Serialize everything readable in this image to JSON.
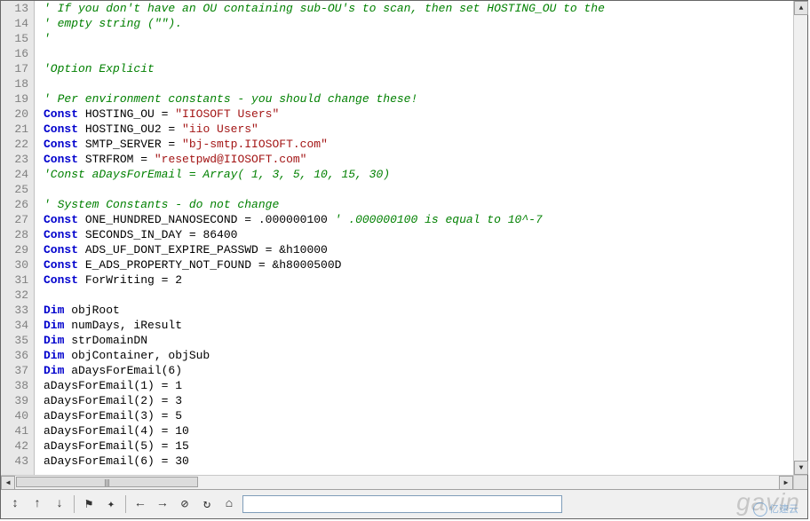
{
  "line_start": 13,
  "lines": [
    [
      {
        "t": "comment",
        "v": "' If you don't have an OU containing sub-OU's to scan, then set HOSTING_OU to the"
      }
    ],
    [
      {
        "t": "comment",
        "v": "' empty string (\"\")."
      }
    ],
    [
      {
        "t": "comment",
        "v": "'"
      }
    ],
    [],
    [
      {
        "t": "comment",
        "v": "'Option Explicit"
      }
    ],
    [],
    [
      {
        "t": "comment",
        "v": "' Per environment constants - you should change these!"
      }
    ],
    [
      {
        "t": "kw",
        "v": "Const"
      },
      {
        "t": "ident",
        "v": " HOSTING_OU = "
      },
      {
        "t": "str",
        "v": "\"IIOSOFT Users\""
      }
    ],
    [
      {
        "t": "kw",
        "v": "Const"
      },
      {
        "t": "ident",
        "v": " HOSTING_OU2 = "
      },
      {
        "t": "str",
        "v": "\"iio Users\""
      }
    ],
    [
      {
        "t": "kw",
        "v": "Const"
      },
      {
        "t": "ident",
        "v": " SMTP_SERVER = "
      },
      {
        "t": "str",
        "v": "\"bj-smtp.IIOSOFT.com\""
      }
    ],
    [
      {
        "t": "kw",
        "v": "Const"
      },
      {
        "t": "ident",
        "v": " STRFROM = "
      },
      {
        "t": "str",
        "v": "\"resetpwd@IIOSOFT.com\""
      }
    ],
    [
      {
        "t": "comment",
        "v": "'Const aDaysForEmail = Array( 1, 3, 5, 10, 15, 30)"
      }
    ],
    [],
    [
      {
        "t": "comment",
        "v": "' System Constants - do not change"
      }
    ],
    [
      {
        "t": "kw",
        "v": "Const"
      },
      {
        "t": "ident",
        "v": " ONE_HUNDRED_NANOSECOND = .000000100 "
      },
      {
        "t": "comment",
        "v": "' .000000100 is equal to 10^-7"
      }
    ],
    [
      {
        "t": "kw",
        "v": "Const"
      },
      {
        "t": "ident",
        "v": " SECONDS_IN_DAY = 86400"
      }
    ],
    [
      {
        "t": "kw",
        "v": "Const"
      },
      {
        "t": "ident",
        "v": " ADS_UF_DONT_EXPIRE_PASSWD = &h10000"
      }
    ],
    [
      {
        "t": "kw",
        "v": "Const"
      },
      {
        "t": "ident",
        "v": " E_ADS_PROPERTY_NOT_FOUND = &h8000500D"
      }
    ],
    [
      {
        "t": "kw",
        "v": "Const"
      },
      {
        "t": "ident",
        "v": " ForWriting = 2"
      }
    ],
    [],
    [
      {
        "t": "kw",
        "v": "Dim"
      },
      {
        "t": "ident",
        "v": " objRoot"
      }
    ],
    [
      {
        "t": "kw",
        "v": "Dim"
      },
      {
        "t": "ident",
        "v": " numDays, iResult"
      }
    ],
    [
      {
        "t": "kw",
        "v": "Dim"
      },
      {
        "t": "ident",
        "v": " strDomainDN"
      }
    ],
    [
      {
        "t": "kw",
        "v": "Dim"
      },
      {
        "t": "ident",
        "v": " objContainer, objSub"
      }
    ],
    [
      {
        "t": "kw",
        "v": "Dim"
      },
      {
        "t": "ident",
        "v": " aDaysForEmail(6)"
      }
    ],
    [
      {
        "t": "ident",
        "v": "aDaysForEmail(1) = 1"
      }
    ],
    [
      {
        "t": "ident",
        "v": "aDaysForEmail(2) = 3"
      }
    ],
    [
      {
        "t": "ident",
        "v": "aDaysForEmail(3) = 5"
      }
    ],
    [
      {
        "t": "ident",
        "v": "aDaysForEmail(4) = 10"
      }
    ],
    [
      {
        "t": "ident",
        "v": "aDaysForEmail(5) = 15"
      }
    ],
    [
      {
        "t": "ident",
        "v": "aDaysForEmail(6) = 30"
      }
    ]
  ],
  "toolbar": {
    "buttons": [
      {
        "name": "next-outer-icon",
        "glyph": "↕"
      },
      {
        "name": "arrow-up-icon",
        "glyph": "↑"
      },
      {
        "name": "arrow-down-icon",
        "glyph": "↓"
      },
      {
        "name": "sep"
      },
      {
        "name": "bookmark-toggle-icon",
        "glyph": "⚑"
      },
      {
        "name": "bookmark-clear-icon",
        "glyph": "✦"
      },
      {
        "name": "sep"
      },
      {
        "name": "nav-back-icon",
        "glyph": "←"
      },
      {
        "name": "nav-forward-icon",
        "glyph": "→"
      },
      {
        "name": "stop-icon",
        "glyph": "⊘"
      },
      {
        "name": "refresh-icon",
        "glyph": "↻"
      },
      {
        "name": "home-icon",
        "glyph": "⌂"
      }
    ],
    "combo_value": ""
  },
  "watermark_main": "gavin",
  "watermark_sub": "亿速云"
}
